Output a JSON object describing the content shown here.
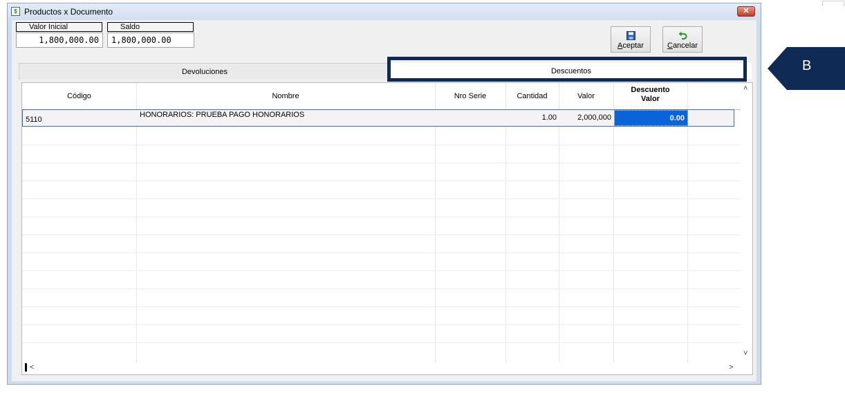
{
  "window": {
    "title": "Productos x Documento",
    "close_glyph": "✕",
    "icon_glyph": "$"
  },
  "fields": {
    "valor_inicial": {
      "label": "Valor Inicial",
      "value": "1,800,000.00"
    },
    "saldo": {
      "label": "Saldo",
      "value": "1,800,000.00"
    }
  },
  "toolbar": {
    "aceptar": {
      "accel": "A",
      "rest": "ceptar",
      "icon": "save-icon"
    },
    "cancelar": {
      "accel": "C",
      "rest": "ancelar",
      "icon": "undo-icon"
    }
  },
  "tabs": {
    "devoluciones": "Devoluciones",
    "descuentos": "Descuentos"
  },
  "grid": {
    "columns": {
      "codigo": "Código",
      "nombre": "Nombre",
      "nro_serie": "Nro Serie",
      "cantidad": "Cantidad",
      "valor": "Valor",
      "descuento_line1": "Descuento",
      "descuento_line2": "Valor"
    },
    "rows": [
      {
        "codigo": "5110",
        "nombre": "HONORARIOS: PRUEBA PAGO HONORARIOS",
        "nro_serie": "",
        "cantidad": "1.00",
        "valor": "2,000,000",
        "descuento_valor": "0.00"
      }
    ]
  },
  "scroll": {
    "up": "˄",
    "down": "˅",
    "left": "<",
    "right": ">"
  },
  "annotation": {
    "label": "B",
    "color": "#0f2a55"
  }
}
